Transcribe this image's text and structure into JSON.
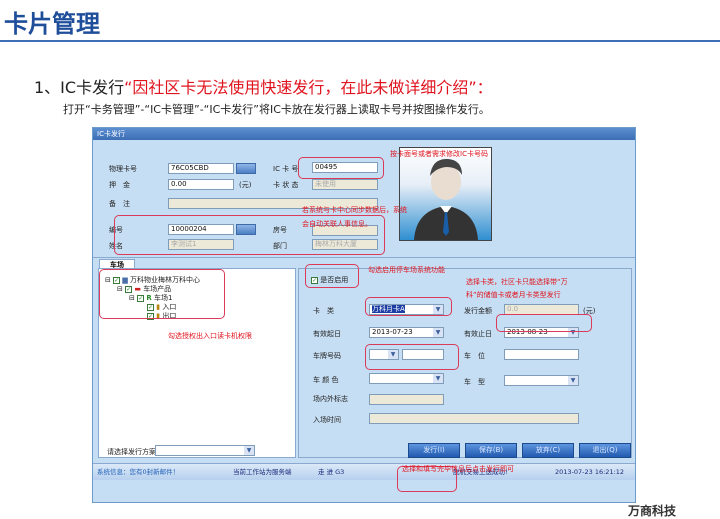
{
  "slide": {
    "title": "卡片管理",
    "heading_prefix": "1、IC卡发行",
    "heading_quote": "“因社区卡无法使用快速发行，在此未做详细介绍”：",
    "instruction": "打开“卡务管理”-“IC卡管理”-“IC卡发行”将IC卡放在发行器上读取卡号并按图操作发行。",
    "logo": "万商科技"
  },
  "window": {
    "title": "IC卡发行",
    "upper": {
      "phys_card_label": "物理卡号",
      "phys_card": "76C05CBD",
      "deposit_label": "押　金",
      "deposit": "0.00",
      "yuan": "(元)",
      "ic_label": "IC 卡 号",
      "ic_no": "00495",
      "status_label": "卡 状 态",
      "status": "未使用",
      "remark_label": "备　注",
      "id_label": "编号",
      "id": "10000204",
      "room_label": "房号",
      "name_label": "姓名",
      "name": "李测试1",
      "dept_label": "部门",
      "dept": "梅林万科大厦"
    },
    "tab": "车场",
    "tree": [
      "万科物业梅林万科中心",
      "车场产品",
      "车场1",
      "入口",
      "出口"
    ],
    "right": {
      "enable": "是否启用",
      "card_type_label": "卡　类",
      "card_type": "万科月卡A",
      "amount_label": "发行金额",
      "amount": "0.0",
      "yuan": "(元)",
      "start_label": "有效起日",
      "start": "2013-07-23",
      "end_label": "有效止日",
      "end": "2013-08-23",
      "plate_label": "车牌号码",
      "slot_label": "车　位",
      "color_label": "车 颜 色",
      "model_label": "车　型",
      "inout_label": "场内外标志",
      "entry_label": "入场时间"
    },
    "plan_label": "请选择发行方案",
    "buttons": [
      "发行(I)",
      "保存(B)",
      "放弃(C)",
      "退出(Q)"
    ],
    "statusbar": {
      "msg": "系统信息：您有0封新邮件！",
      "station": "当前工作站为服务端",
      "user": "走 进 G3",
      "upload": "脱机交易上送成功!",
      "time": "2013-07-23 16:21:12"
    }
  },
  "notes": {
    "ic": "按卡面号或者需求修改IC卡号码",
    "sync": "若系统与卡中心同步数据后，系统",
    "sync2": "会自动关联人事信息。",
    "tree": "勾选授权出入口读卡机权限",
    "enable": "勾选启用停车场系统功能",
    "type": "选择卡类，社区卡只能选择带“万",
    "type2": "科”的储值卡或者月卡类型发行",
    "issue": "选择和填写完毕信息后点击发行即可"
  }
}
